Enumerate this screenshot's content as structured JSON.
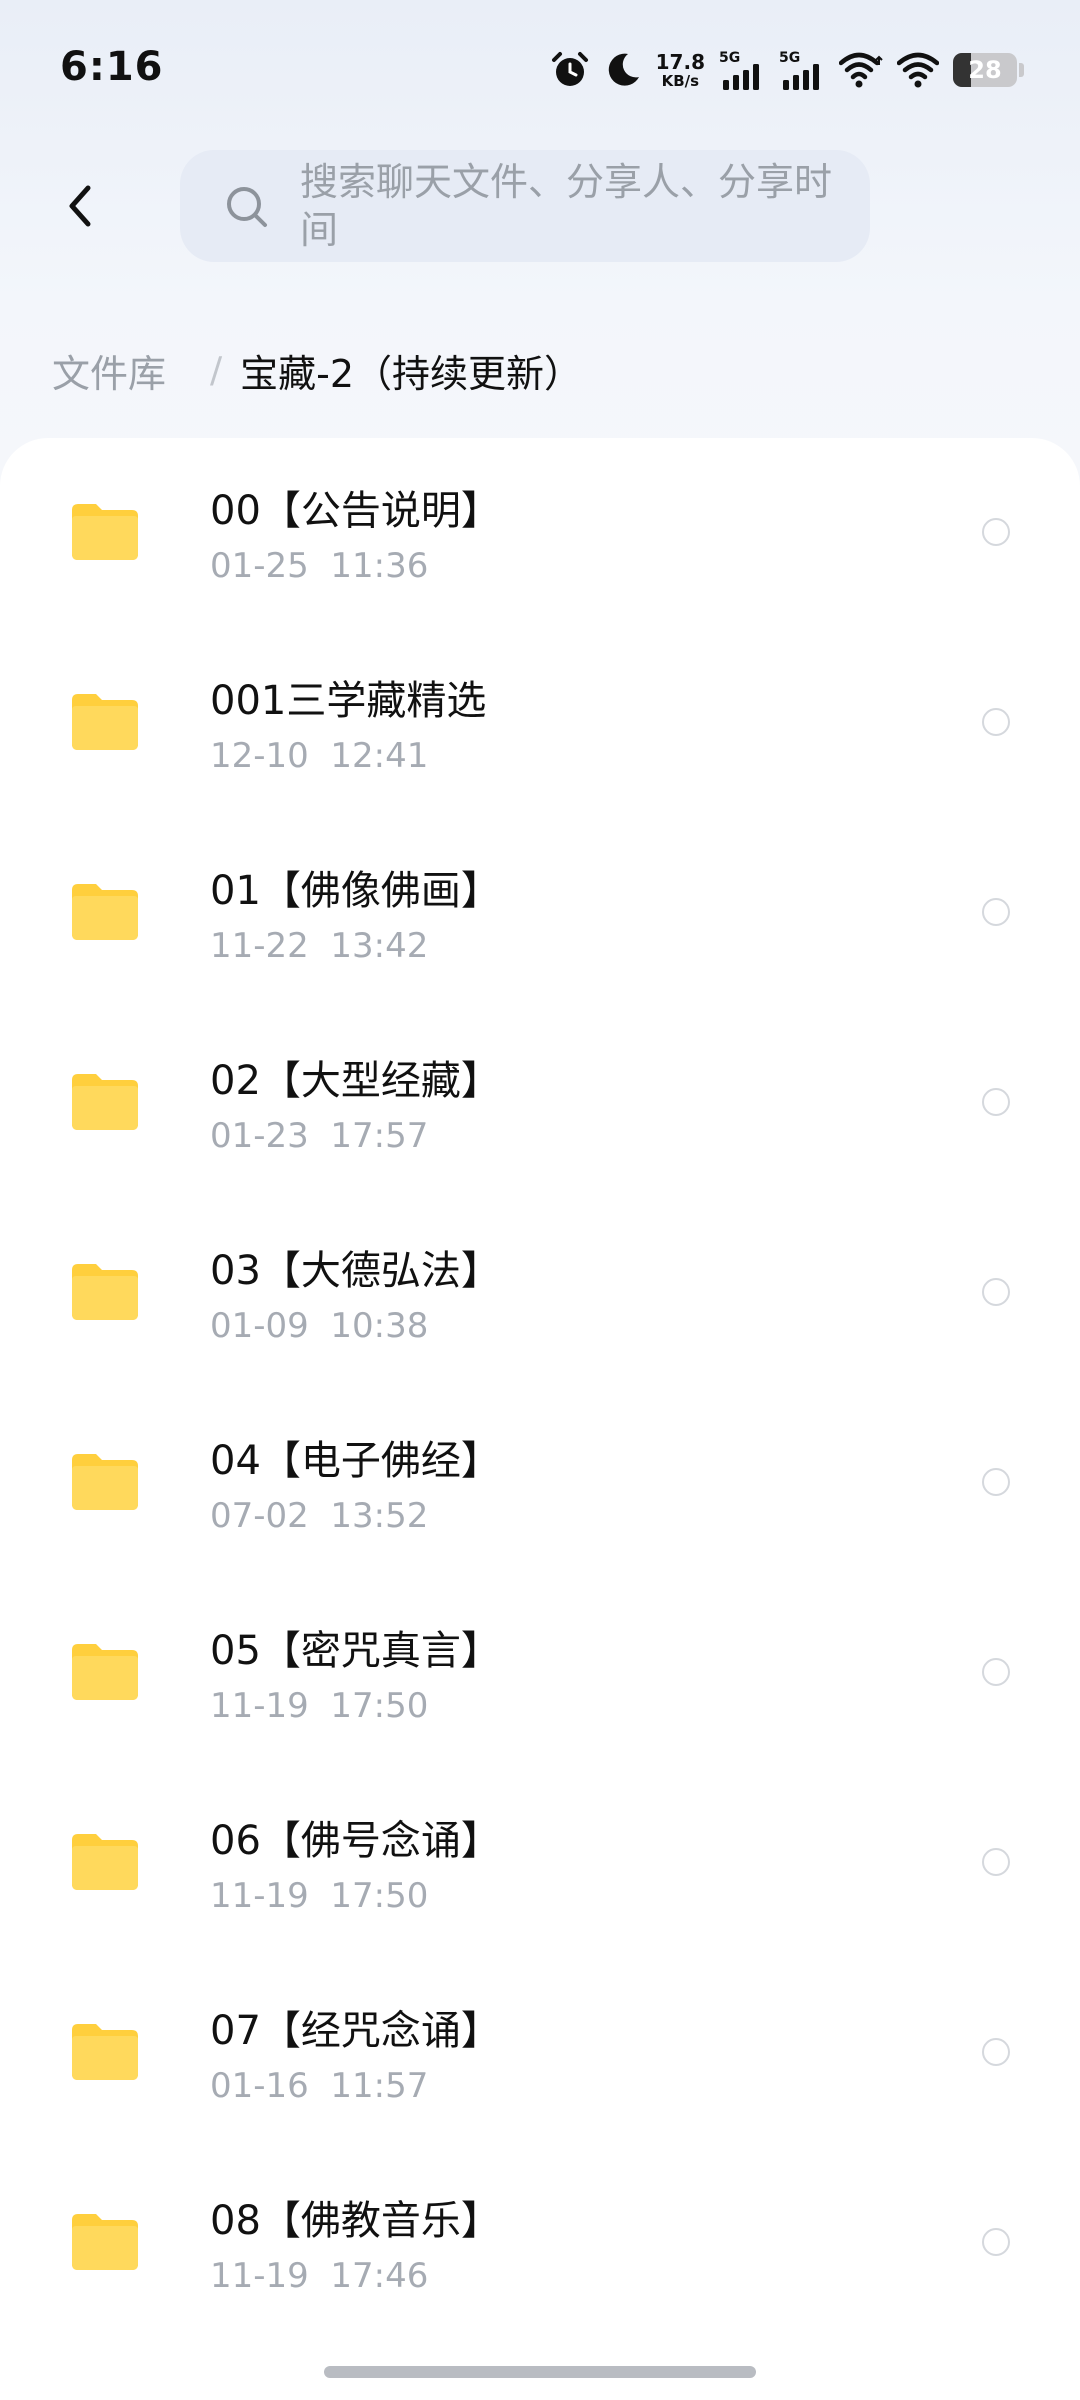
{
  "status_bar": {
    "time": "6:16",
    "net_speed_value": "17.8",
    "net_speed_unit": "KB/s",
    "sim1_label": "5G",
    "sim2_label": "5G",
    "battery_level": "28",
    "battery_fraction": 0.28
  },
  "header": {
    "search_placeholder": "搜索聊天文件、分享人、分享时间"
  },
  "breadcrumb": {
    "root": "文件库",
    "separator": "/",
    "current": "宝藏-2（持续更新）"
  },
  "files": [
    {
      "name": "00【公告说明】",
      "time": "01-25  11:36"
    },
    {
      "name": "001三学藏精选",
      "time": "12-10  12:41"
    },
    {
      "name": "01【佛像佛画】",
      "time": "11-22  13:42"
    },
    {
      "name": "02【大型经藏】",
      "time": "01-23  17:57"
    },
    {
      "name": "03【大德弘法】",
      "time": "01-09  10:38"
    },
    {
      "name": "04【电子佛经】",
      "time": "07-02  13:52"
    },
    {
      "name": "05【密咒真言】",
      "time": "11-19  17:50"
    },
    {
      "name": "06【佛号念诵】",
      "time": "11-19  17:50"
    },
    {
      "name": "07【经咒念诵】",
      "time": "01-16  11:57"
    },
    {
      "name": "08【佛教音乐】",
      "time": "11-19  17:46"
    }
  ],
  "colors": {
    "folder": "#ffd54f",
    "folder_tab": "#ffcf3d",
    "accent_text": "#111111",
    "muted_text": "#a6abb3"
  }
}
